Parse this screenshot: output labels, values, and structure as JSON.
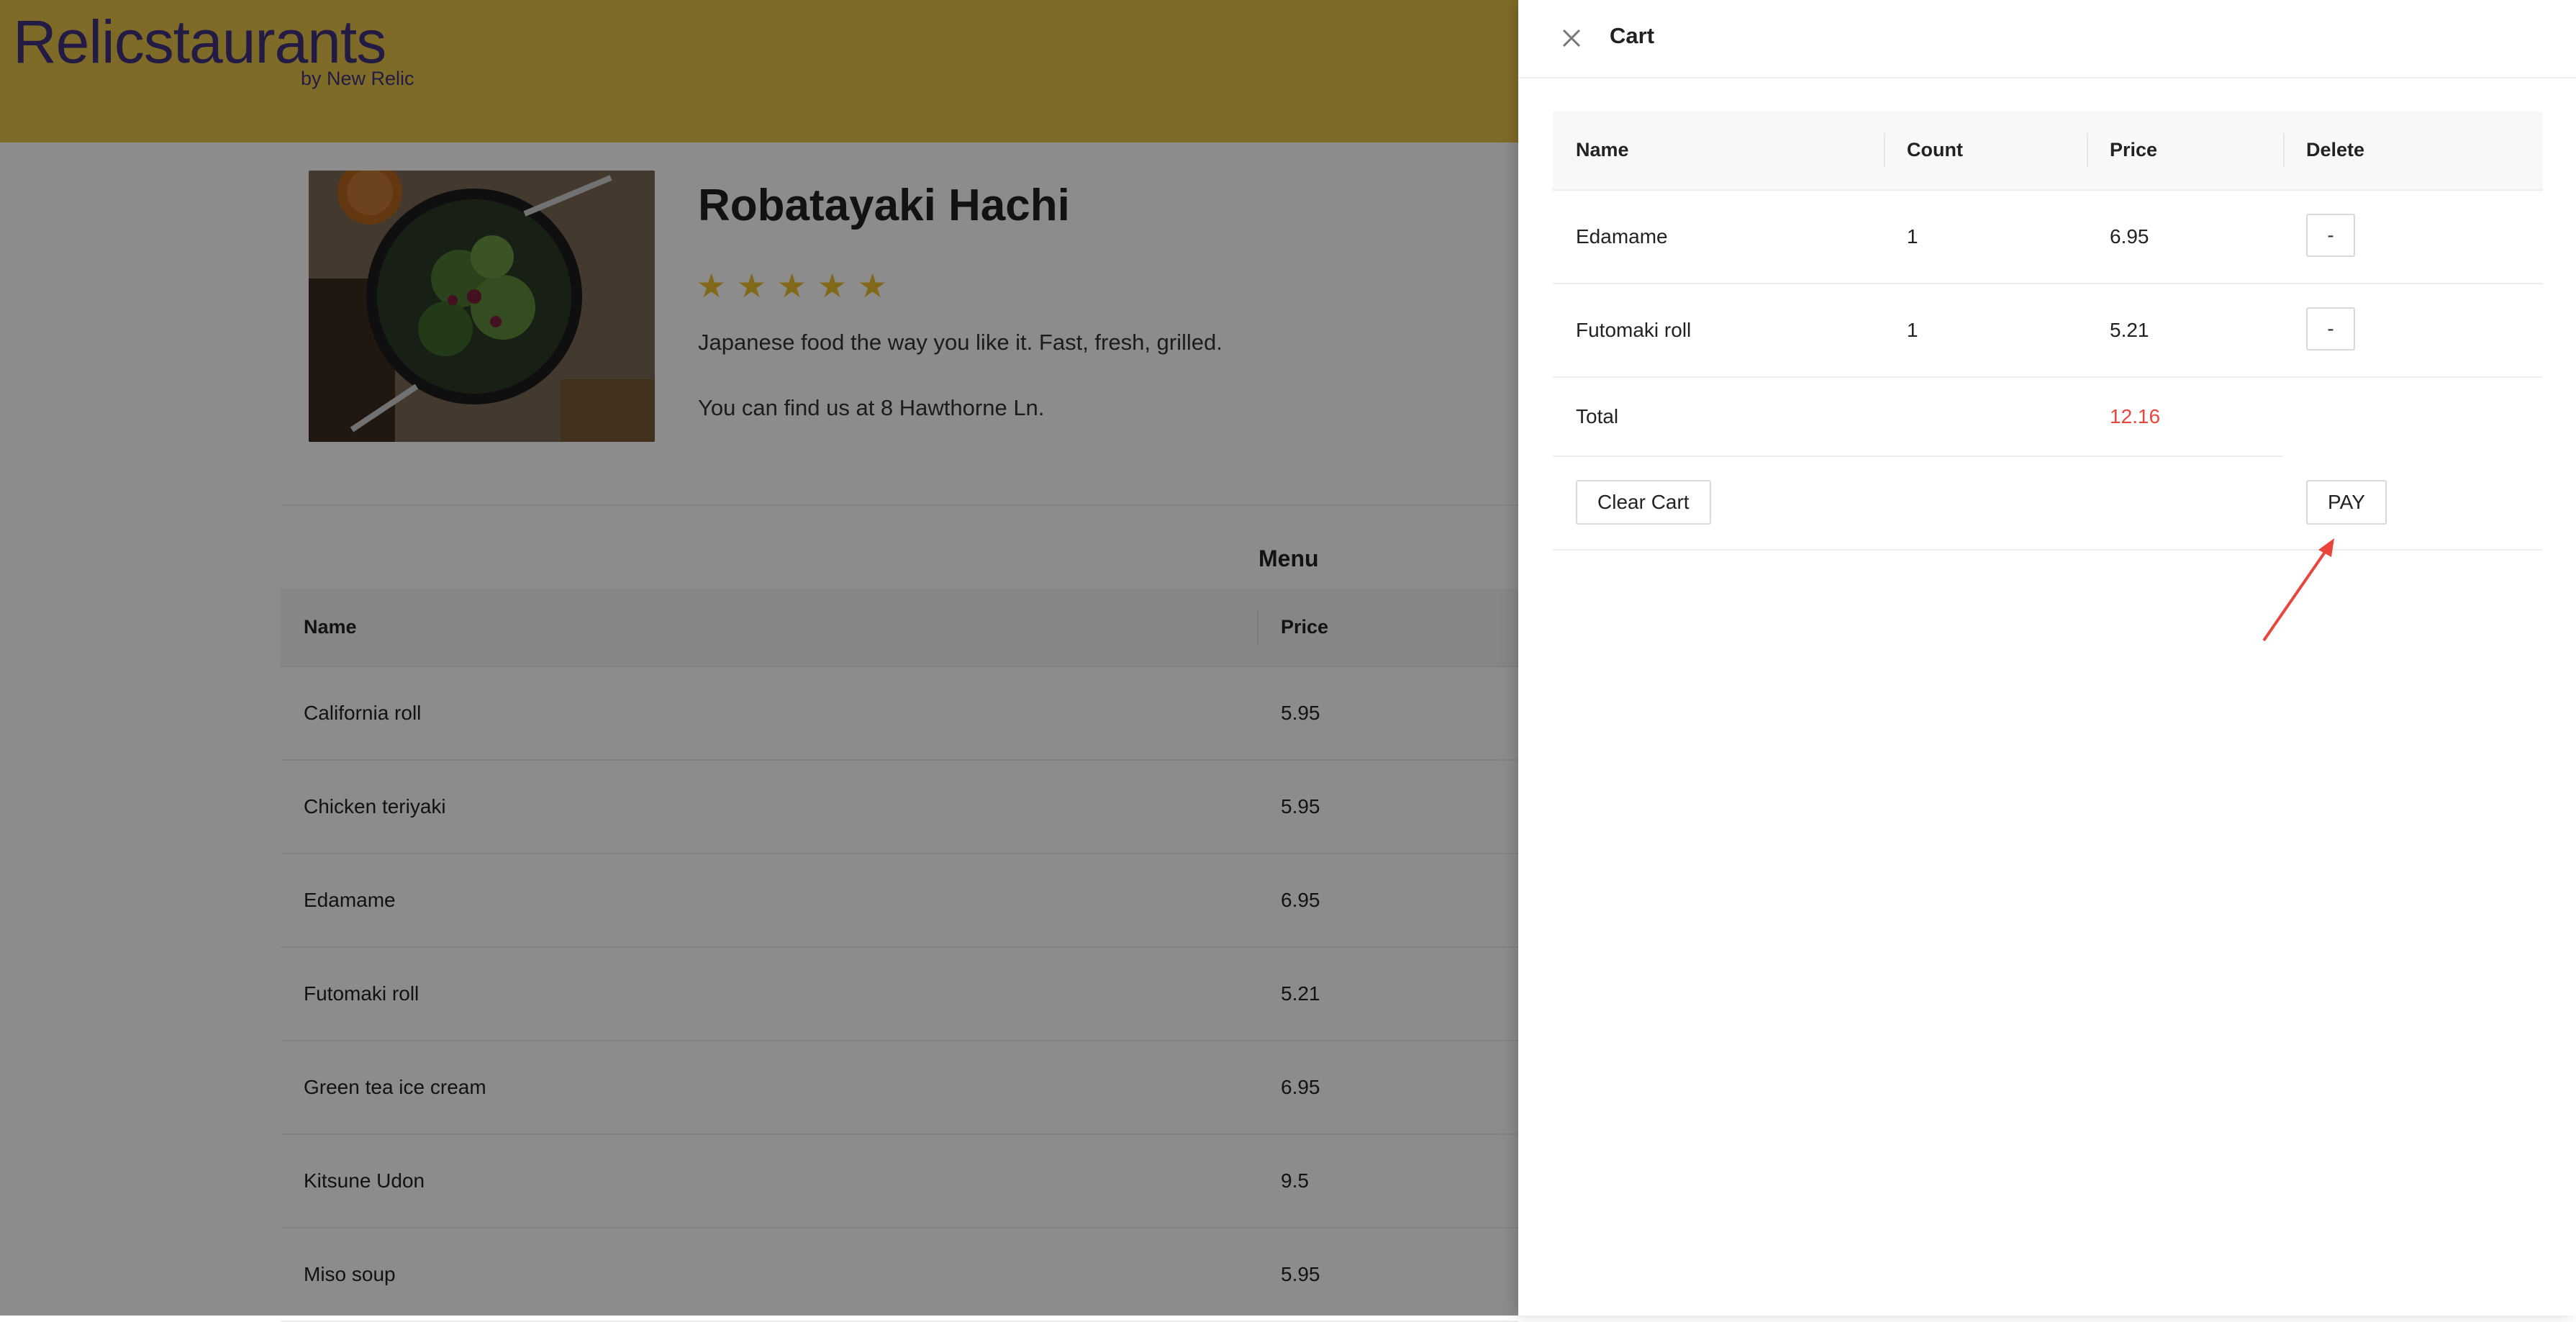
{
  "header": {
    "brand": "Relicstaurants",
    "brand_sub": "by New Relic"
  },
  "restaurant": {
    "name": "Robatayaki Hachi",
    "rating_stars": 5,
    "description": "Japanese food the way you like it. Fast, fresh, grilled.",
    "address": "You can find us at 8 Hawthorne Ln."
  },
  "menu": {
    "title": "Menu",
    "columns": {
      "name": "Name",
      "price": "Price"
    },
    "items": [
      {
        "name": "California roll",
        "price": "5.95"
      },
      {
        "name": "Chicken teriyaki",
        "price": "5.95"
      },
      {
        "name": "Edamame",
        "price": "6.95"
      },
      {
        "name": "Futomaki roll",
        "price": "5.21"
      },
      {
        "name": "Green tea ice cream",
        "price": "6.95"
      },
      {
        "name": "Kitsune Udon",
        "price": "9.5"
      },
      {
        "name": "Miso soup",
        "price": "5.95"
      }
    ]
  },
  "cart": {
    "title": "Cart",
    "columns": {
      "name": "Name",
      "count": "Count",
      "price": "Price",
      "delete": "Delete"
    },
    "items": [
      {
        "name": "Edamame",
        "count": "1",
        "price": "6.95",
        "delete_label": "-"
      },
      {
        "name": "Futomaki roll",
        "count": "1",
        "price": "5.21",
        "delete_label": "-"
      }
    ],
    "total_label": "Total",
    "total_value": "12.16",
    "clear_label": "Clear Cart",
    "pay_label": "PAY"
  },
  "colors": {
    "header_bg": "#e7c34a",
    "brand_text": "#40327a",
    "star": "#e9c12f",
    "total_value": "#e8463c",
    "annotation_arrow": "#e8463c"
  }
}
